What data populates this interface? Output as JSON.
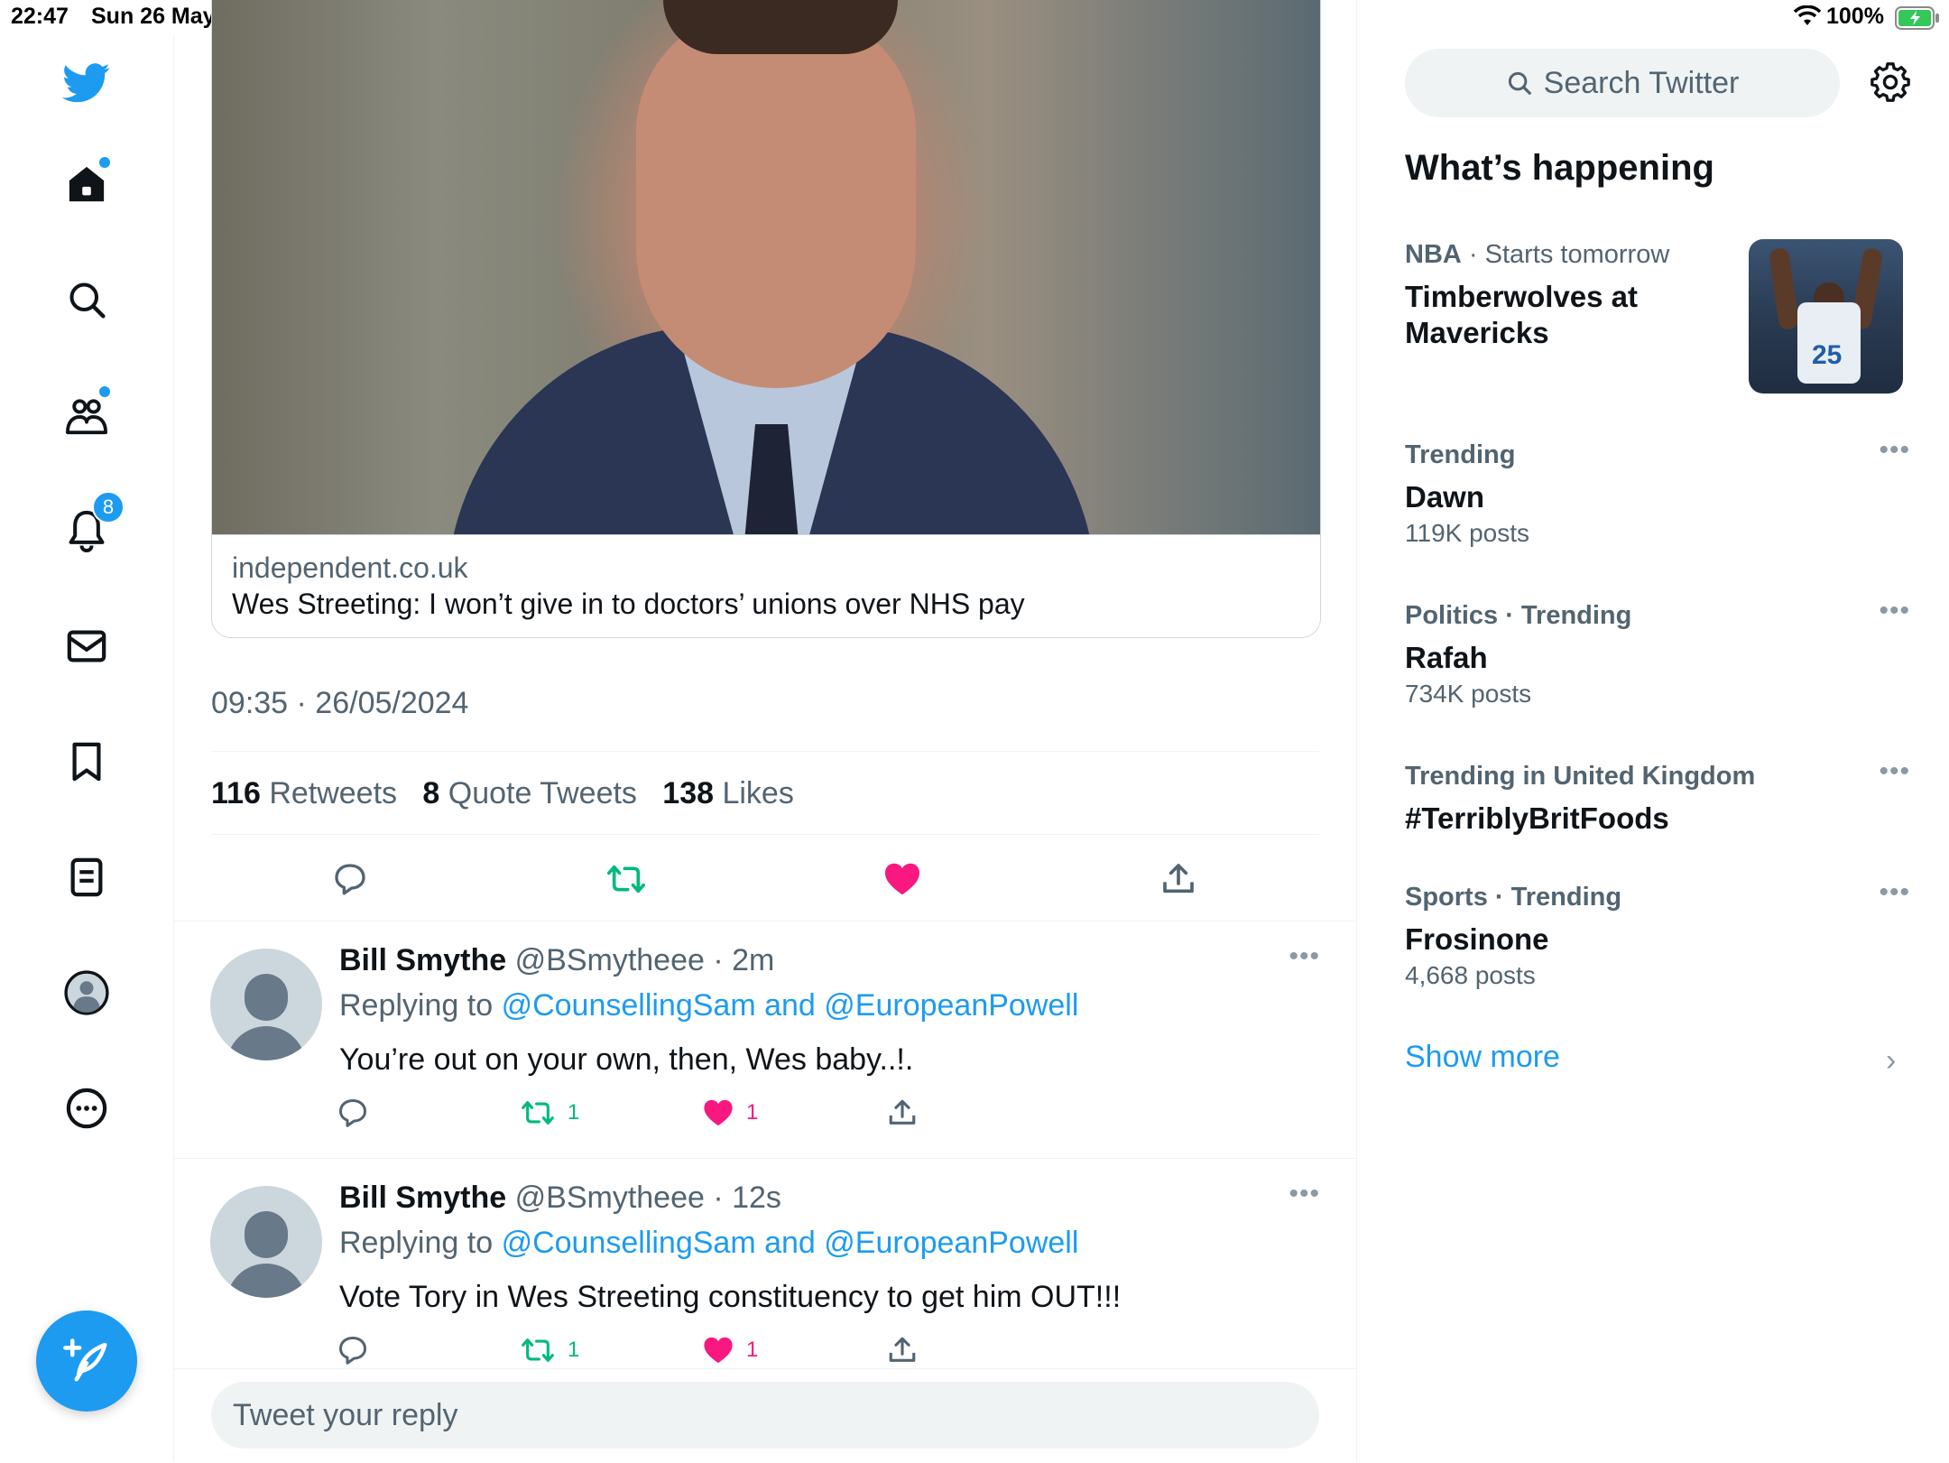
{
  "status_bar": {
    "time": "22:47",
    "date": "Sun 26 May",
    "battery_percent": "100%"
  },
  "nav": {
    "items": [
      {
        "name": "home",
        "icon": "home-icon"
      },
      {
        "name": "explore",
        "icon": "search-icon"
      },
      {
        "name": "communities",
        "icon": "communities-icon"
      },
      {
        "name": "notifications",
        "icon": "bell-icon",
        "badge": "8"
      },
      {
        "name": "messages",
        "icon": "mail-icon"
      },
      {
        "name": "bookmarks",
        "icon": "bookmark-icon"
      },
      {
        "name": "lists",
        "icon": "list-icon"
      },
      {
        "name": "profile",
        "icon": "avatar-icon"
      },
      {
        "name": "more",
        "icon": "more-circle-icon"
      }
    ]
  },
  "tweet": {
    "card": {
      "domain": "independent.co.uk",
      "title": "Wes Streeting: I won’t give in to doctors’ unions over NHS pay"
    },
    "timestamp": "09:35 · 26/05/2024",
    "stats": {
      "retweets_count": "116",
      "retweets_label": "Retweets",
      "quotes_count": "8",
      "quotes_label": "Quote Tweets",
      "likes_count": "138",
      "likes_label": "Likes"
    }
  },
  "replies": [
    {
      "name": "Bill Smythe",
      "handle": "@BSmytheee · 2m",
      "replying_prefix": "Replying to",
      "replying_to": "@CounsellingSam and @EuropeanPowell",
      "text": "You’re out on your own, then, Wes baby..!.",
      "retweets": "1",
      "likes": "1"
    },
    {
      "name": "Bill Smythe",
      "handle": "@BSmytheee · 12s",
      "replying_prefix": "Replying to",
      "replying_to": "@CounsellingSam and @EuropeanPowell",
      "text": "Vote Tory in Wes Streeting constituency to get him OUT!!!",
      "retweets": "1",
      "likes": "1"
    }
  ],
  "reply_box": {
    "placeholder": "Tweet your reply"
  },
  "sidebar": {
    "search_placeholder": "Search Twitter",
    "title": "What’s happening",
    "trends": [
      {
        "category": "NBA",
        "meta": " · Starts tomorrow",
        "title": "Timberwolves at Mavericks",
        "count": ""
      },
      {
        "category": "Trending",
        "meta": "",
        "title": "Dawn",
        "count": "119K posts"
      },
      {
        "category": "Politics · Trending",
        "meta": "",
        "title": "Rafah",
        "count": "734K posts"
      },
      {
        "category": "Trending in United Kingdom",
        "meta": "",
        "title": "#TerriblyBritFoods",
        "count": ""
      },
      {
        "category": "Sports · Trending",
        "meta": "",
        "title": "Frosinone",
        "count": "4,668 posts"
      }
    ],
    "show_more": "Show more"
  },
  "colors": {
    "accent": "#1d9bf0",
    "retweet": "#00ba7c",
    "like": "#f91880",
    "muted": "#536471"
  }
}
